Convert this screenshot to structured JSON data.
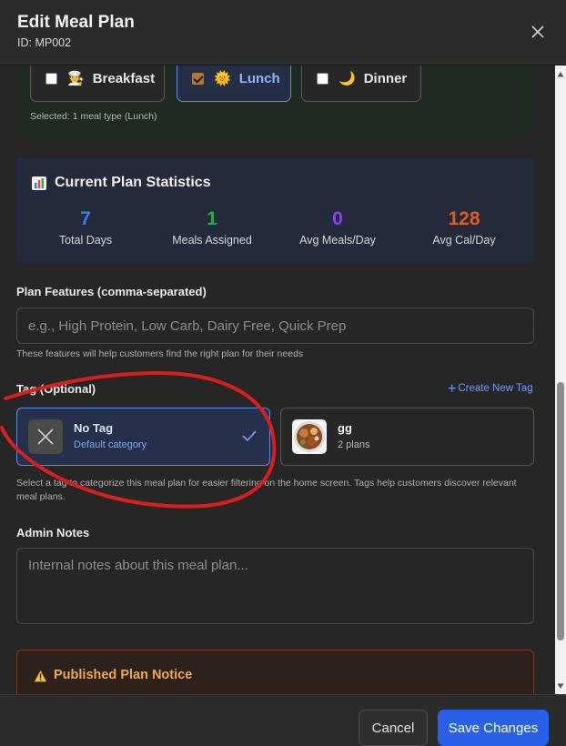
{
  "header": {
    "title": "Edit Meal Plan",
    "subtitle": "ID: MP002",
    "close_icon": "close-icon"
  },
  "meal_types": {
    "options": [
      {
        "label": "Breakfast",
        "icon": "🧑‍🍳",
        "checked": false
      },
      {
        "label": "Lunch",
        "icon": "🌞",
        "checked": true
      },
      {
        "label": "Dinner",
        "icon": "🌙",
        "checked": false
      }
    ],
    "selected_text": "Selected: 1 meal type (Lunch)"
  },
  "stats": {
    "title": "Current Plan Statistics",
    "icon": "bar-chart-icon",
    "items": [
      {
        "value": "7",
        "label": "Total Days",
        "color": "#3b78f2"
      },
      {
        "value": "1",
        "label": "Meals Assigned",
        "color": "#2fa84f"
      },
      {
        "value": "0",
        "label": "Avg Meals/Day",
        "color": "#8a3ff0"
      },
      {
        "value": "128",
        "label": "Avg Cal/Day",
        "color": "#e45c1c"
      }
    ]
  },
  "features": {
    "label": "Plan Features (comma-separated)",
    "placeholder": "e.g., High Protein, Low Carb, Dairy Free, Quick Prep",
    "value": "",
    "help": "These features will help customers find the right plan for their needs"
  },
  "tags": {
    "label": "Tag (Optional)",
    "create_label": "Create New Tag",
    "options": [
      {
        "name": "No Tag",
        "sub": "Default category",
        "selected": true
      },
      {
        "name": "gg",
        "sub": "2 plans",
        "selected": false
      }
    ],
    "help": "Select a tag to categorize this meal plan for easier filtering on the home screen. Tags help customers discover relevant meal plans."
  },
  "admin_notes": {
    "label": "Admin Notes",
    "placeholder": "Internal notes about this meal plan...",
    "value": ""
  },
  "notice": {
    "title": "Published Plan Notice",
    "icon": "warning-icon"
  },
  "footer": {
    "cancel_label": "Cancel",
    "save_label": "Save Changes"
  },
  "colors": {
    "accent": "#2860e8",
    "selected_border": "#5b8cf0",
    "notice_text": "#f0a64a",
    "annotation": "#d81e1e"
  }
}
